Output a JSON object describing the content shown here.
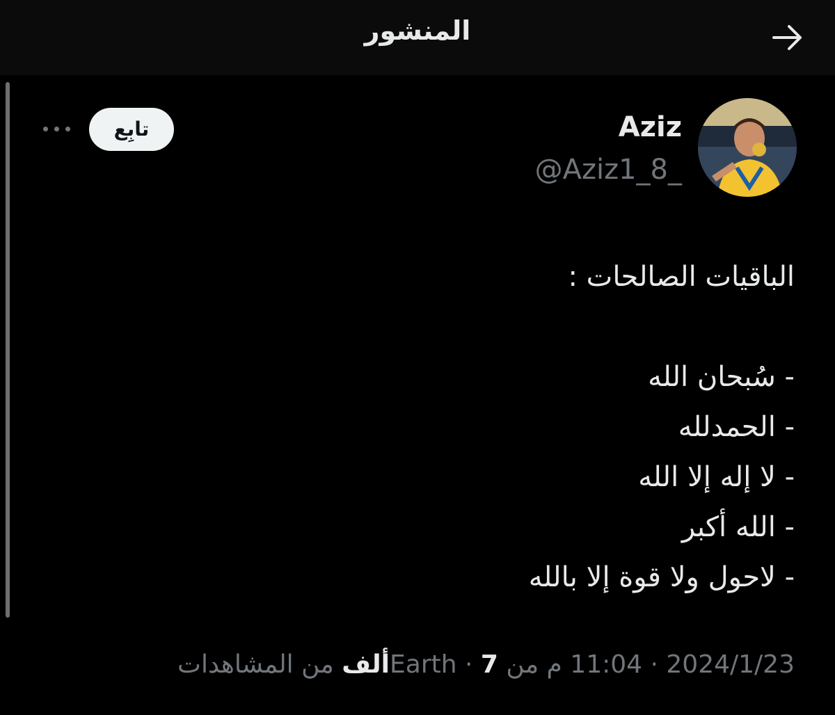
{
  "header": {
    "title": "المنشور",
    "back_icon": "arrow-right-icon"
  },
  "author": {
    "name": "Aziz",
    "handle": "@Aziz1_8_",
    "avatar_icon": "profile-photo"
  },
  "actions": {
    "follow_label": "تابِع",
    "more_icon": "ellipsis-icon"
  },
  "tweet": {
    "lines": [
      "الباقيات الصالحات :",
      "",
      "- سُبحان الله",
      "- الحمدلله",
      "- لا إله إلا الله",
      "- الله أكبر",
      "- لاحول ولا قوة إلا بالله"
    ]
  },
  "meta": {
    "time": "11:04 م من Earth",
    "date": "2024/1/23",
    "views_count": "7ألف",
    "views_label": "من المشاهدات",
    "separator": "·"
  }
}
